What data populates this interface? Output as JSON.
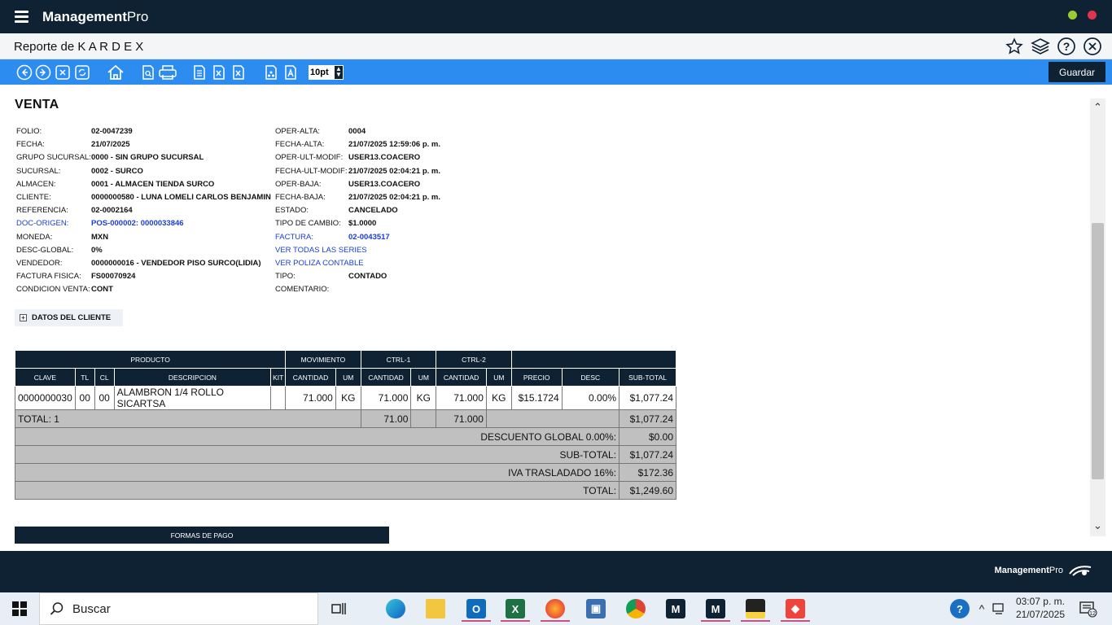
{
  "app": {
    "brand_main": "Management",
    "brand_pro": "Pro"
  },
  "titlebar": {
    "title": "Reporte de K A R D E X"
  },
  "toolbar": {
    "font_size": "10pt",
    "save_label": "Guardar"
  },
  "section": {
    "title": "VENTA"
  },
  "left_fields": [
    {
      "label": "FOLIO:",
      "value": "02-0047239",
      "link": false
    },
    {
      "label": "FECHA:",
      "value": "21/07/2025",
      "link": false
    },
    {
      "label": "GRUPO SUCURSAL:",
      "value": "0000 - SIN GRUPO SUCURSAL",
      "link": false
    },
    {
      "label": "SUCURSAL:",
      "value": "0002 - SURCO",
      "link": false
    },
    {
      "label": "ALMACEN:",
      "value": "0001 - ALMACEN TIENDA SURCO",
      "link": false
    },
    {
      "label": "CLIENTE:",
      "value": "0000000580 - LUNA LOMELI CARLOS BENJAMIN",
      "link": false
    },
    {
      "label": "REFERENCIA:",
      "value": "02-0002164",
      "link": false
    },
    {
      "label": "DOC-ORIGEN:",
      "value": "POS-000002: 0000033846",
      "link": true
    },
    {
      "label": "MONEDA:",
      "value": "MXN",
      "link": false
    },
    {
      "label": "DESC-GLOBAL:",
      "value": "0%",
      "link": false
    },
    {
      "label": "VENDEDOR:",
      "value": "0000000016 - VENDEDOR PISO SURCO(LIDIA)",
      "link": false
    },
    {
      "label": "FACTURA FISICA:",
      "value": "FS00070924",
      "link": false
    },
    {
      "label": "CONDICION VENTA:",
      "value": "CONT",
      "link": false
    }
  ],
  "right_fields": [
    {
      "label": "OPER-ALTA:",
      "value": "0004",
      "link": false
    },
    {
      "label": "FECHA-ALTA:",
      "value": "21/07/2025 12:59:06 p. m.",
      "link": false
    },
    {
      "label": "OPER-ULT-MODIF:",
      "value": "USER13.COACERO",
      "link": false
    },
    {
      "label": "FECHA-ULT-MODIF:",
      "value": "21/07/2025 02:04:21 p. m.",
      "link": false
    },
    {
      "label": "OPER-BAJA:",
      "value": "USER13.COACERO",
      "link": false
    },
    {
      "label": "FECHA-BAJA:",
      "value": "21/07/2025 02:04:21 p. m.",
      "link": false
    },
    {
      "label": "ESTADO:",
      "value": "CANCELADO",
      "link": false
    },
    {
      "label": "TIPO DE CAMBIO:",
      "value": "$1.0000",
      "link": false
    },
    {
      "label": "FACTURA:",
      "value": "02-0043517",
      "link": true
    },
    {
      "label": "VER TODAS LAS SERIES",
      "value": "",
      "link": true
    },
    {
      "label": "VER POLIZA CONTABLE",
      "value": "",
      "link": true
    },
    {
      "label": "TIPO:",
      "value": "CONTADO",
      "link": false
    },
    {
      "label": "COMENTARIO:",
      "value": "",
      "link": false
    }
  ],
  "client_section": {
    "label": "DATOS DEL CLIENTE"
  },
  "table": {
    "group_headers": [
      "PRODUCTO",
      "MOVIMIENTO",
      "CTRL-1",
      "CTRL-2"
    ],
    "columns": [
      "CLAVE",
      "TL",
      "CL",
      "DESCRIPCION",
      "KIT",
      "CANTIDAD",
      "UM",
      "CANTIDAD",
      "UM",
      "CANTIDAD",
      "UM",
      "PRECIO",
      "DESC",
      "SUB-TOTAL"
    ],
    "rows": [
      {
        "clave": "0000000030",
        "tl": "00",
        "cl": "00",
        "descripcion": "ALAMBRON 1/4 ROLLO SICARTSA",
        "kit": "",
        "mov_cant": "71.000",
        "mov_um": "KG",
        "c1_cant": "71.000",
        "c1_um": "KG",
        "c2_cant": "71.000",
        "c2_um": "KG",
        "precio": "$15.1724",
        "desc": "0.00%",
        "subtotal": "$1,077.24"
      }
    ],
    "total_label": "TOTAL: 1",
    "total_c1": "71.00",
    "total_c2": "71.000",
    "total_subtotal": "$1,077.24",
    "summary": [
      {
        "label": "DESCUENTO GLOBAL 0.00%:",
        "value": "$0.00"
      },
      {
        "label": "SUB-TOTAL:",
        "value": "$1,077.24"
      },
      {
        "label": "IVA TRASLADADO 16%:",
        "value": "$172.36"
      },
      {
        "label": "TOTAL:",
        "value": "$1,249.60"
      }
    ]
  },
  "payment": {
    "label": "FORMAS DE PAGO"
  },
  "footer": {
    "brand_main": "Management",
    "brand_pro": "Pro"
  },
  "taskbar": {
    "search_placeholder": "Buscar",
    "time": "03:07 p. m.",
    "date": "21/07/2025",
    "notification_count": "12"
  },
  "colors": {
    "primary": "#0e2233",
    "toolbar": "#2d8cf0",
    "link": "#1a3ed6"
  }
}
